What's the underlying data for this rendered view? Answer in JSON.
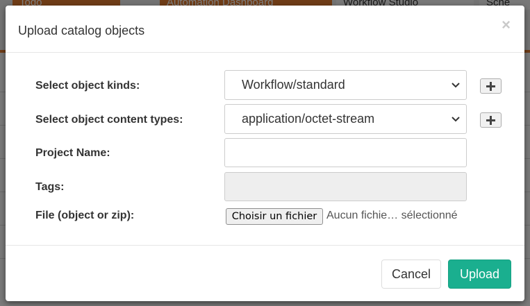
{
  "background": {
    "tabs": [
      "Todo",
      "Automation Dashboard",
      "Workflow Studio",
      "Sche"
    ]
  },
  "modal": {
    "title": "Upload catalog objects",
    "close_glyph": "×",
    "fields": {
      "object_kinds": {
        "label": "Select object kinds:",
        "value": "Workflow/standard"
      },
      "content_types": {
        "label": "Select object content types:",
        "value": "application/octet-stream"
      },
      "project_name": {
        "label": "Project Name:",
        "value": ""
      },
      "tags": {
        "label": "Tags:",
        "value": ""
      },
      "file": {
        "label": "File (object or zip):",
        "button_label": "Choisir un fichier",
        "status": "Aucun fichie… sélectionné"
      }
    },
    "buttons": {
      "cancel": "Cancel",
      "upload": "Upload"
    },
    "colors": {
      "upload_bg": "#1aaf8f",
      "accent_orange": "#e07a2e"
    }
  }
}
